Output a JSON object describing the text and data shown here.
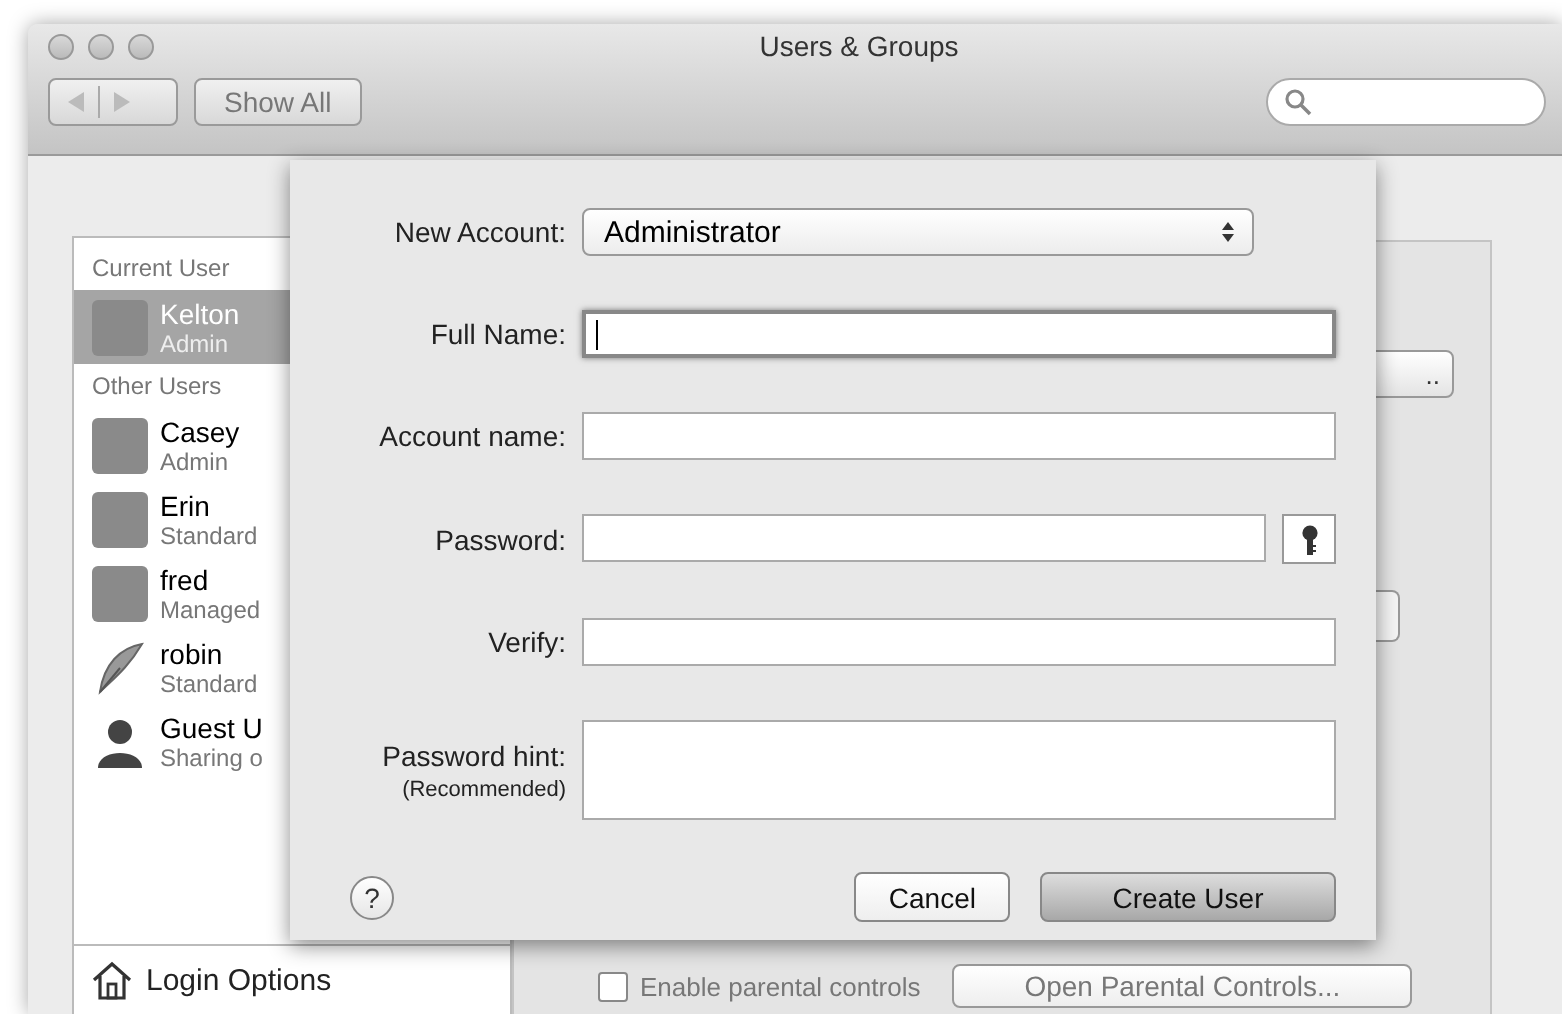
{
  "window": {
    "title": "Users & Groups"
  },
  "toolbar": {
    "show_all": "Show All"
  },
  "sidebar": {
    "sections": [
      {
        "heading": "Current User",
        "users": [
          {
            "name": "Kelton",
            "role": "Admin",
            "kind": "photo",
            "selected": true
          }
        ]
      },
      {
        "heading": "Other Users",
        "users": [
          {
            "name": "Casey",
            "role": "Admin",
            "kind": "photo",
            "selected": false
          },
          {
            "name": "Erin",
            "role": "Standard",
            "kind": "photo",
            "selected": false
          },
          {
            "name": "fred",
            "role": "Managed",
            "kind": "photo",
            "selected": false
          },
          {
            "name": "robin",
            "role": "Standard",
            "kind": "feather",
            "selected": false
          },
          {
            "name": "Guest U",
            "role": "Sharing o",
            "kind": "silhouette",
            "selected": false
          }
        ]
      }
    ],
    "login_options": "Login Options"
  },
  "pane": {
    "change_password_tail": "..",
    "parental_controls": {
      "label": "Enable parental controls",
      "checked": false
    },
    "open_parental_controls": "Open Parental Controls..."
  },
  "sheet": {
    "fields": [
      {
        "kind": "popup",
        "label": "New Account:",
        "value": "Administrator"
      },
      {
        "kind": "text",
        "label": "Full Name:",
        "focused": true
      },
      {
        "kind": "text",
        "label": "Account name:",
        "focused": false
      },
      {
        "kind": "password",
        "label": "Password:",
        "focused": false
      },
      {
        "kind": "text",
        "label": "Verify:",
        "focused": false
      },
      {
        "kind": "textarea",
        "label": "Password hint:",
        "note": "(Recommended)",
        "focused": false
      }
    ],
    "help": "?",
    "cancel": "Cancel",
    "create_user": "Create User"
  }
}
